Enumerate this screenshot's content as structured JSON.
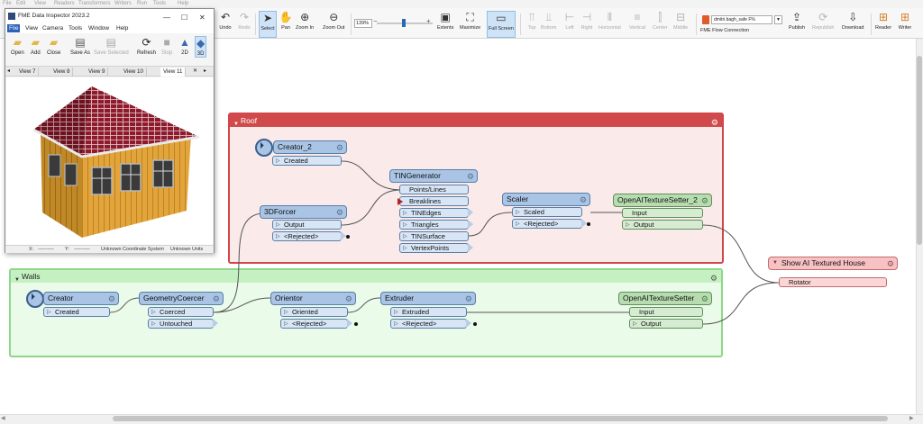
{
  "menubar": [
    "File",
    "Edit",
    "View",
    "Readers",
    "Transformers",
    "Writers",
    "Run",
    "Tools",
    "Help"
  ],
  "toolbar": {
    "undo": "Undo",
    "redo": "Redo",
    "select": "Select",
    "pan": "Pan",
    "zoom_in": "Zoom In",
    "zoom_out": "Zoom Out",
    "zoom_level": "139%",
    "extents": "Extents",
    "maximize": "Maximize",
    "full_screen": "Full Screen",
    "top": "Top",
    "bottom": "Bottom",
    "left": "Left",
    "right": "Right",
    "horizontal": "Horizontal",
    "vertical": "Vertical",
    "center": "Center",
    "middle": "Middle",
    "connection_value": "dmitri.bagh_safe F%",
    "connection_label": "FME Flow Connection",
    "publish": "Publish",
    "republish": "Republish",
    "download": "Download",
    "reader": "Reader",
    "writer": "Writer"
  },
  "inspector": {
    "title": "FME Data Inspector 2023.2",
    "menu": [
      "File",
      "View",
      "Camera",
      "Tools",
      "Window",
      "Help"
    ],
    "tools": {
      "open": "Open",
      "add": "Add",
      "close": "Close",
      "save_as": "Save As",
      "save_selected": "Save Selected",
      "refresh": "Refresh",
      "stop": "Stop",
      "two_d": "2D",
      "three_d": "3D"
    },
    "tabs": [
      "View 7",
      "View 8",
      "View 9",
      "View 10",
      "View 11"
    ],
    "status": {
      "x": "X:",
      "x_val": "----------",
      "y": "Y:",
      "y_val": "----------",
      "coord": "Unknown Coordinate System",
      "units": "Unknown Units"
    }
  },
  "bookmarks": {
    "roof": {
      "title": "Roof"
    },
    "walls": {
      "title": "Walls"
    }
  },
  "transformers": {
    "creator2": {
      "name": "Creator_2",
      "ports": [
        "Created"
      ]
    },
    "forcer": {
      "name": "3DForcer",
      "ports": [
        "Output",
        "<Rejected>"
      ]
    },
    "tin": {
      "name": "TINGenerator",
      "inputs": [
        "Points/Lines",
        "Breaklines"
      ],
      "outputs": [
        "TINEdges",
        "Triangles",
        "TINSurface",
        "VertexPoints"
      ]
    },
    "scaler": {
      "name": "Scaler",
      "ports": [
        "Scaled",
        "<Rejected>"
      ]
    },
    "tex2": {
      "name": "OpenAITextureSetter_2",
      "inputs": [
        "Input"
      ],
      "outputs": [
        "Output"
      ]
    },
    "creator": {
      "name": "Creator",
      "ports": [
        "Created"
      ]
    },
    "coercer": {
      "name": "GeometryCoercer",
      "ports": [
        "Coerced",
        "Untouched"
      ]
    },
    "orientor": {
      "name": "Orientor",
      "ports": [
        "Oriented",
        "<Rejected>"
      ]
    },
    "extruder": {
      "name": "Extruder",
      "ports": [
        "Extruded",
        "<Rejected>"
      ]
    },
    "tex1": {
      "name": "OpenAITextureSetter",
      "inputs": [
        "Input"
      ],
      "outputs": [
        "Output"
      ]
    },
    "show": {
      "name": "Show AI Textured House",
      "ports": [
        "Rotator"
      ]
    }
  },
  "colors": {
    "roof_fill": "#fbeaea",
    "roof_border": "#d1474a",
    "walls_fill": "#ebfbea",
    "walls_border": "#8fd68b",
    "transformer": "#a9c4e4",
    "accent": "#2b63b8"
  }
}
